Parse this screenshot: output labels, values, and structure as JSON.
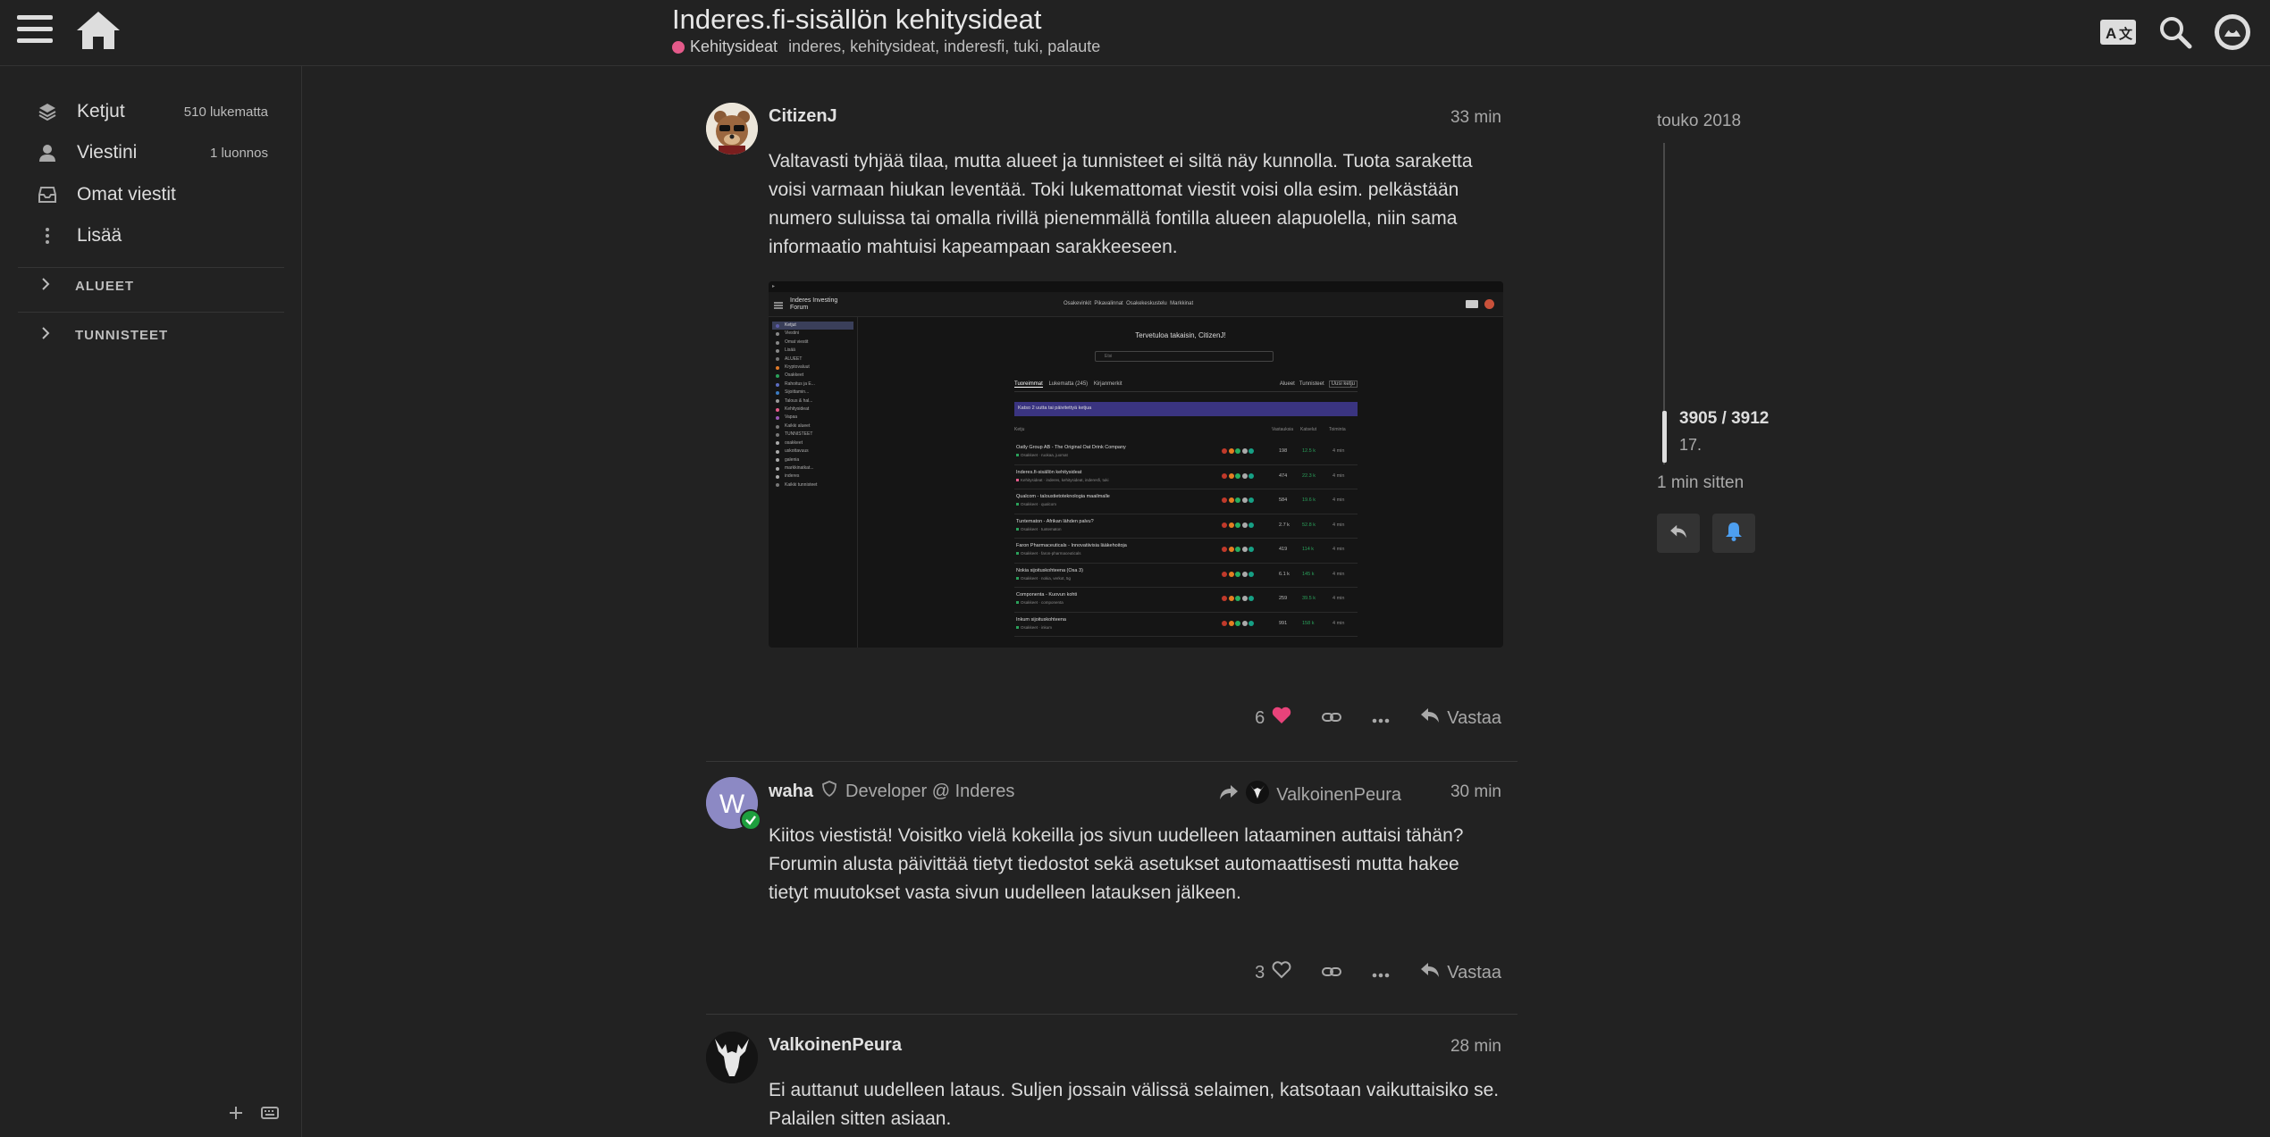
{
  "header": {
    "title": "Inderes.fi-sisällön kehitysideat",
    "category": "Kehitysideat",
    "category_color": "#e45a8a",
    "tags": "inderes, kehitysideat, inderesfi, tuki, palaute"
  },
  "sidebar": {
    "items": [
      {
        "label": "Ketjut",
        "count": "510 lukematta",
        "icon": "layers-icon"
      },
      {
        "label": "Viestini",
        "count": "1 luonnos",
        "icon": "user-icon"
      },
      {
        "label": "Omat viestit",
        "count": "",
        "icon": "inbox-icon"
      },
      {
        "label": "Lisää",
        "count": "",
        "icon": "vertical-dots-icon"
      }
    ],
    "sections": [
      "ALUEET",
      "TUNNISTEET"
    ]
  },
  "posts": [
    {
      "author": "CitizenJ",
      "time": "33 min",
      "body": "Valtavasti tyhjää tilaa, mutta alueet ja tunnisteet ei siltä näy kunnolla. Tuota saraketta voisi varmaan hiukan leventää. Toki lukemattomat viestit voisi olla esim. pelkästään numero suluissa tai omalla rivillä pienemmällä fontilla alueen alapuolella, niin sama informaatio mahtuisi kapeampaan sarakkeeseen.",
      "likes": "6",
      "reply_label": "Vastaa"
    },
    {
      "author": "waha",
      "title": "Developer @ Inderes",
      "reply_to": "ValkoinenPeura",
      "time": "30 min",
      "avatar_letter": "W",
      "body": "Kiitos viestistä! Voisitko vielä kokeilla jos sivun uudelleen lataaminen auttaisi tähän? Forumin alusta päivittää tietyt tiedostot sekä asetukset automaattisesti mutta hakee tietyt muutokset vasta sivun uudelleen latauksen jälkeen.",
      "likes": "3",
      "reply_label": "Vastaa"
    },
    {
      "author": "ValkoinenPeura",
      "time": "28 min",
      "body": "Ei auttanut uudelleen lataus. Suljen jossain välissä selaimen, katsotaan vaikuttaisiko se. Palailen sitten asiaan."
    }
  ],
  "embedded_screenshot": {
    "forum_name": "Inderes Investing Forum",
    "welcome": "Tervetuloa takaisin, CitizenJ!",
    "search_placeholder": "Etsi",
    "nav": [
      "Osakevinkit",
      "Pikavalinnat",
      "Osakekeskustelu",
      "Markkinat"
    ],
    "tabs": [
      "Tuoreimmat",
      "Lukematta (245)",
      "Kirjanmerkit"
    ],
    "filters": [
      "Alueet",
      "Tunnisteet",
      "Uusi ketju"
    ],
    "banner": "Katso 2 uutta tai päivitettyä ketjua",
    "col_headers": [
      "Ketju",
      "Vastauksia",
      "Katselut",
      "Toiminta"
    ],
    "topics": [
      {
        "title": "Oatly Group AB - The Original Oat Drink Company",
        "cat": "Osakkeet · ruokaa, juomat",
        "replies": "198",
        "views": "12.5 k",
        "activity": "4 min"
      },
      {
        "title": "Inderes.fi-sisällön kehitysideat",
        "cat": "Kehitysideat · inderes, kehitysideat, inderesfi, tuki",
        "replies": "474",
        "views": "22.3 k",
        "activity": "4 min"
      },
      {
        "title": "Qualcom - taloustietoteknologia maailmalle",
        "cat": "Osakkeet · qualcom",
        "replies": "584",
        "views": "19.6 k",
        "activity": "4 min"
      },
      {
        "title": "Tuntematon - Afrikan lähden palvu?",
        "cat": "Osakkeet · tuntematon",
        "replies": "2.7 k",
        "views": "52.8 k",
        "activity": "4 min"
      },
      {
        "title": "Faron Pharmaceuticals - Innovatiivisia lääkehoitoja",
        "cat": "Osakkeet · faron-pharmaceuticals",
        "replies": "419",
        "views": "114 k",
        "activity": "4 min"
      },
      {
        "title": "Nokia sijoituskohteena (Osa 3)",
        "cat": "Osakkeet · nokia, verkot, 5g",
        "replies": "6.1 k",
        "views": "145 k",
        "activity": "4 min"
      },
      {
        "title": "Componenta - Kuovun kohti",
        "cat": "Osakkeet · componenta",
        "replies": "259",
        "views": "39.5 k",
        "activity": "4 min"
      },
      {
        "title": "Inkum sijoituskohteena",
        "cat": "Osakkeet · inkum",
        "replies": "991",
        "views": "158 k",
        "activity": "4 min"
      }
    ],
    "side_items": [
      "Ketjut",
      "Viestini",
      "Omat viestit",
      "Lisää",
      "ALUEET",
      "Kryptovaluut",
      "Osakkeet",
      "Rahoitus ja E...",
      "Sijoittamin...",
      "Talous & hal...",
      "Kehitysideat",
      "Vapaa",
      "Kaikki alueet",
      "TUNNISTEET",
      "osakkeet",
      "uskottavuus",
      "galenia",
      "markkinatkat...",
      "inderes",
      "Kaikki tunnisteet"
    ]
  },
  "timeline": {
    "date": "touko 2018",
    "position": "3905 / 3912",
    "sub": "17.",
    "ago": "1 min sitten"
  }
}
